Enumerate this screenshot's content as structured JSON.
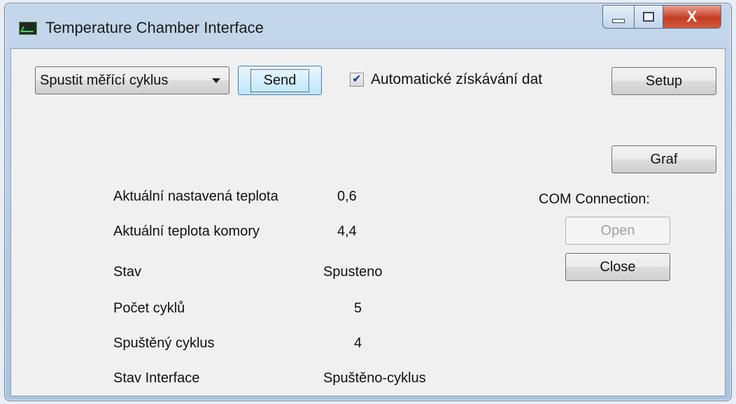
{
  "window": {
    "title": "Temperature Chamber Interface",
    "close_glyph": "X"
  },
  "toolbar": {
    "command_select": "Spustit měřící cyklus",
    "send_label": "Send",
    "auto_data_label": "Automatické získávání dat",
    "auto_data_checked": true,
    "setup_label": "Setup"
  },
  "side": {
    "graph_label": "Graf",
    "com_label": "COM Connection:",
    "open_label": "Open",
    "close_label": "Close"
  },
  "status": {
    "rows": [
      {
        "label": "Aktuální nastavená teplota",
        "value": "0,6"
      },
      {
        "label": "Aktuální teplota komory",
        "value": "4,4"
      },
      {
        "label": "Stav",
        "value": "Spusteno"
      },
      {
        "label": "Počet cyklů",
        "value": "5"
      },
      {
        "label": "Spuštěný cyklus",
        "value": "4"
      },
      {
        "label": "Stav Interface",
        "value": "Spuštěno-cyklus"
      }
    ]
  }
}
